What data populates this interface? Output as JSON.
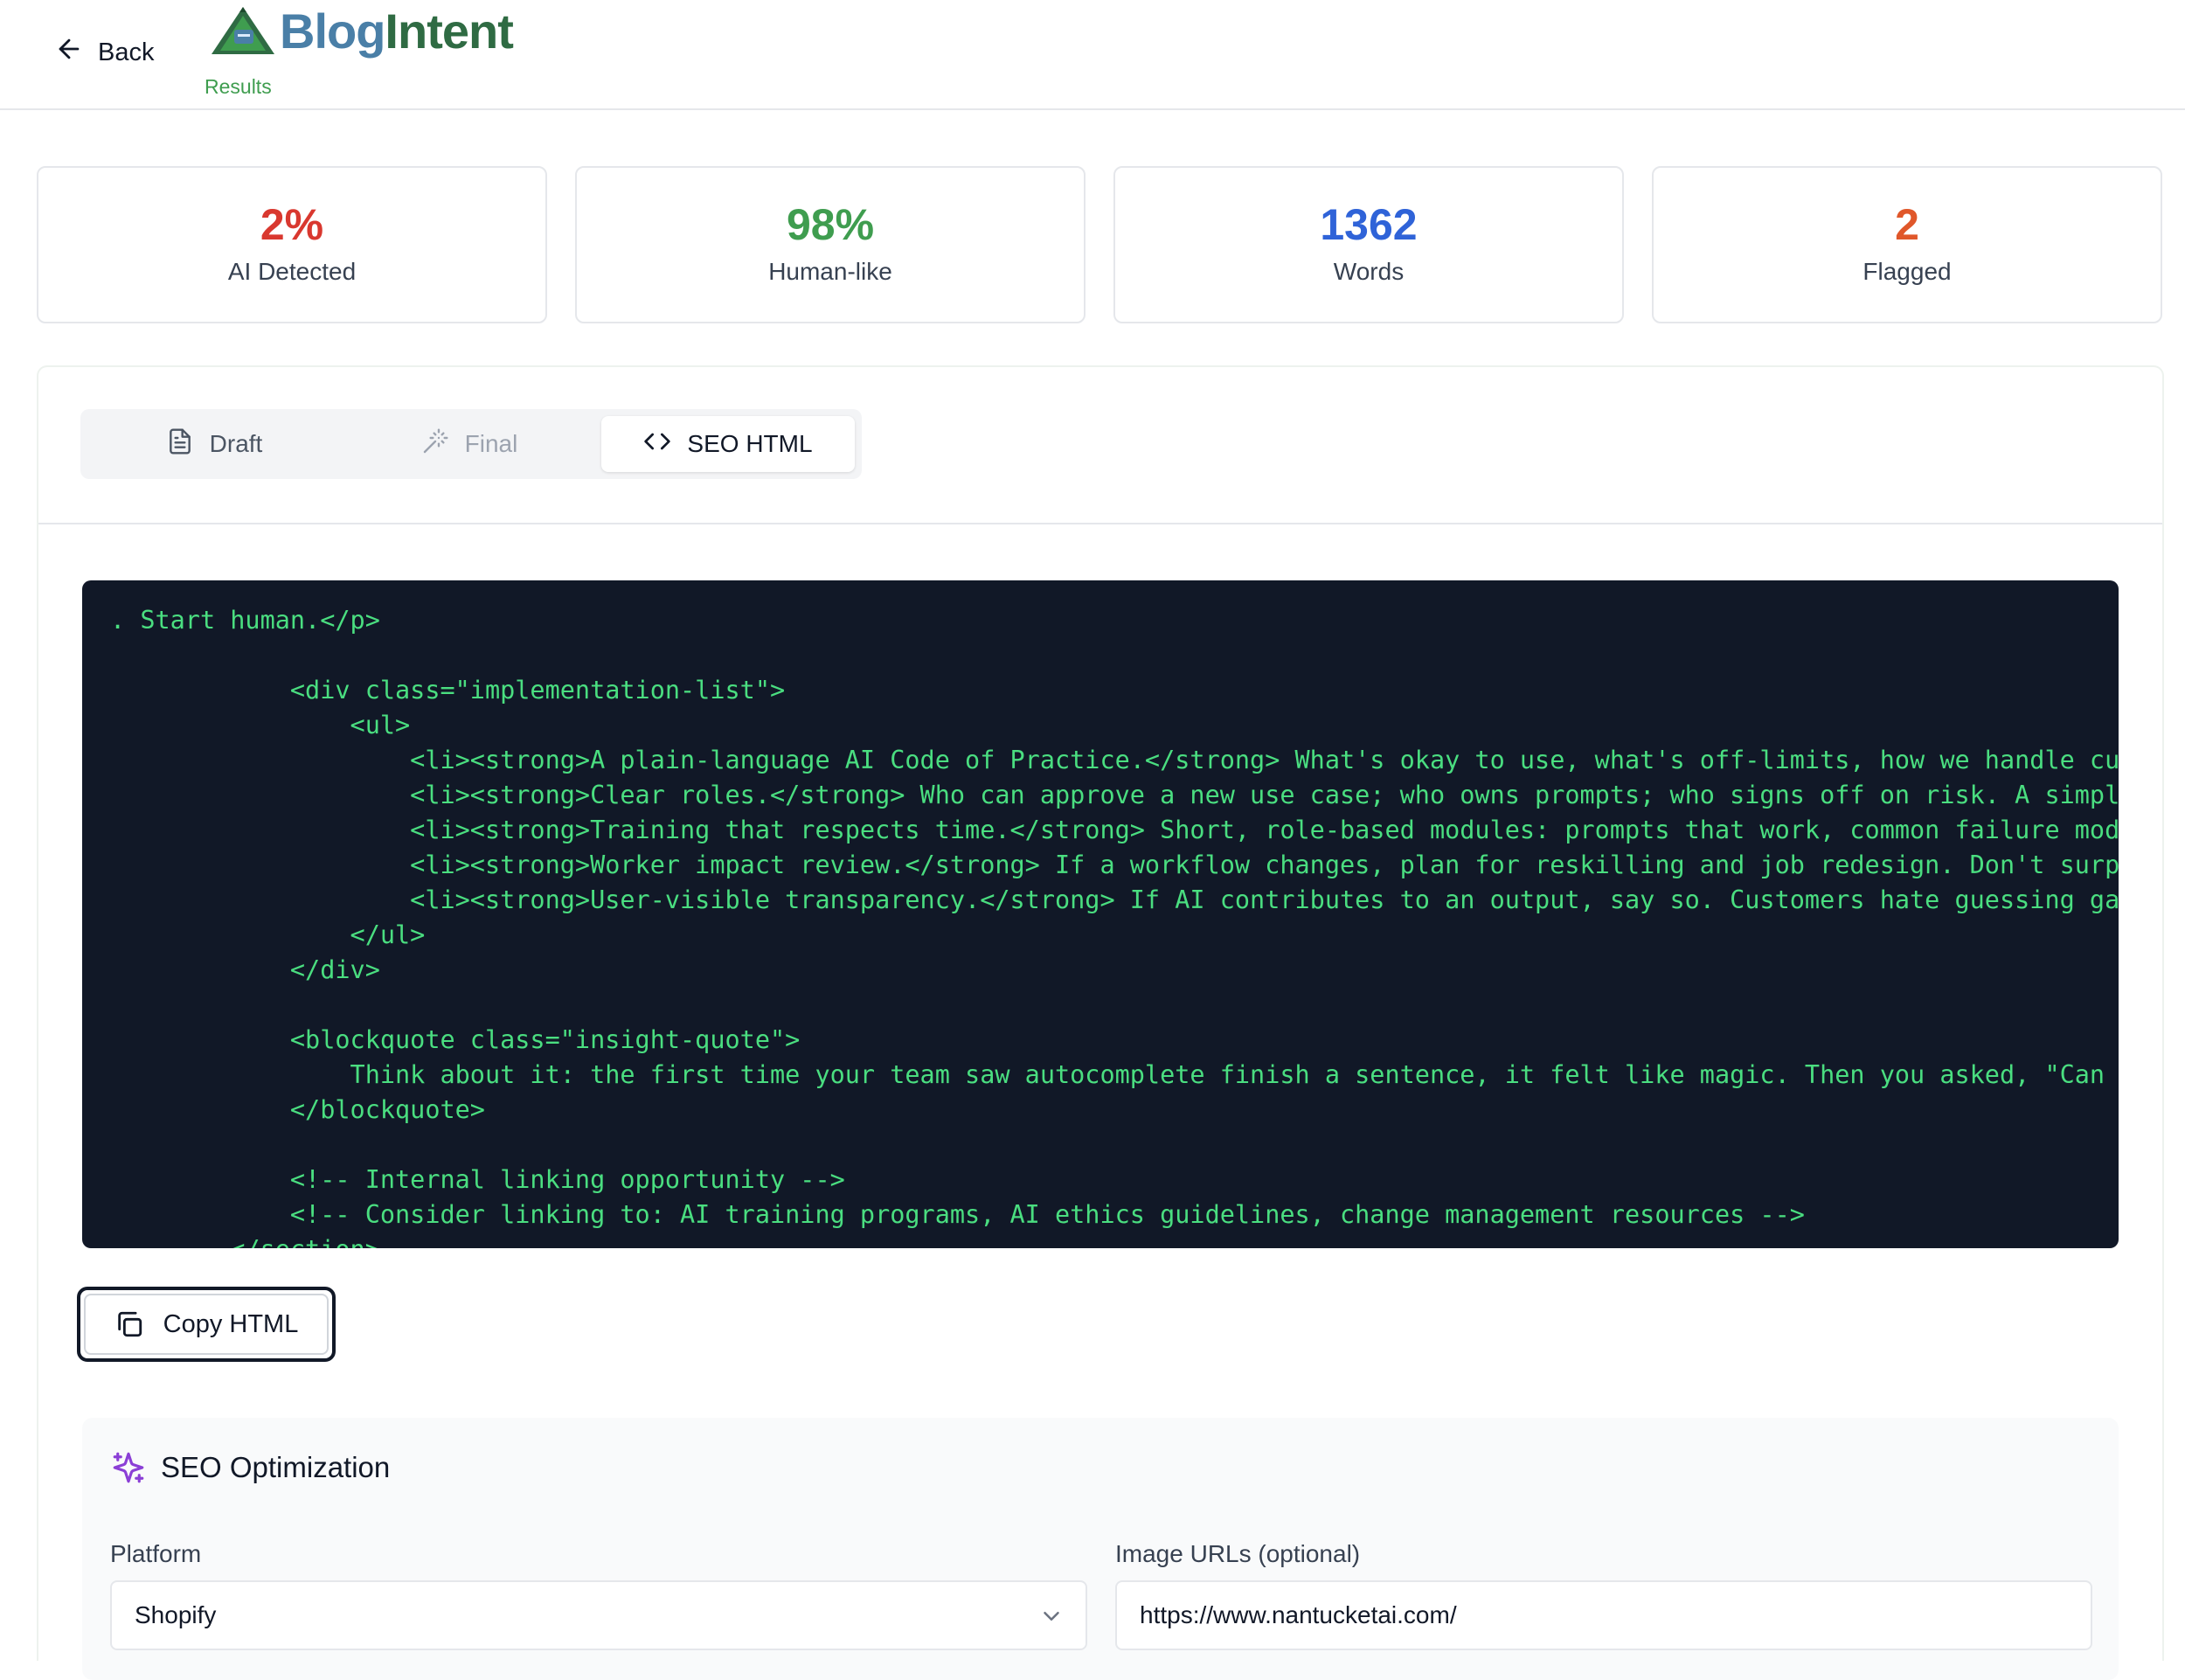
{
  "header": {
    "back_label": "Back",
    "logo_part1": "Blog",
    "logo_part2": "Intent",
    "subtitle": "Results"
  },
  "stats": [
    {
      "value": "2%",
      "label": "AI Detected",
      "color": "#d9382f"
    },
    {
      "value": "98%",
      "label": "Human-like",
      "color": "#3f9d4f"
    },
    {
      "value": "1362",
      "label": "Words",
      "color": "#2f63d8"
    },
    {
      "value": "2",
      "label": "Flagged",
      "color": "#e0572a"
    }
  ],
  "tabs": {
    "draft": "Draft",
    "final": "Final",
    "seo_html": "SEO HTML",
    "active": "SEO HTML"
  },
  "code": {
    "lines": [
      ". Start human.</p>",
      "",
      "            <div class=\"implementation-list\">",
      "                <ul>",
      "                    <li><strong>A plain-language AI Code of Practice.</strong> What's okay to use, what's off-limits, how we handle custo",
      "                    <li><strong>Clear roles.</strong> Who can approve a new use case; who owns prompts; who signs off on risk. A simple R",
      "                    <li><strong>Training that respects time.</strong> Short, role-based modules: prompts that work, common failure modes",
      "                    <li><strong>Worker impact review.</strong> If a workflow changes, plan for reskilling and job redesign. Don't surpri",
      "                    <li><strong>User-visible transparency.</strong> If AI contributes to an output, say so. Customers hate guessing game",
      "                </ul>",
      "            </div>",
      "",
      "            <blockquote class=\"insight-quote\">",
      "                Think about it: the first time your team saw autocomplete finish a sentence, it felt like magic. Then you asked, \"Can I t",
      "            </blockquote>",
      "",
      "            <!-- Internal linking opportunity -->",
      "            <!-- Consider linking to: AI training programs, AI ethics guidelines, change management resources -->",
      "        </section>"
    ]
  },
  "copy_button": {
    "label": "Copy HTML"
  },
  "seo": {
    "title": "SEO Optimization",
    "platform_label": "Platform",
    "platform_value": "Shopify",
    "image_urls_label": "Image URLs (optional)",
    "image_urls_value": "https://www.nantucketai.com/"
  },
  "icons": {
    "back": "arrow-left-icon",
    "draft": "document-icon",
    "final": "magic-wand-icon",
    "seo_html": "code-icon",
    "copy": "copy-icon",
    "seo": "sparkles-icon",
    "dropdown": "chevron-down-icon"
  },
  "colors": {
    "code_bg": "#111827",
    "code_text": "#4ade80",
    "sparkle": "#8b3fd6"
  }
}
